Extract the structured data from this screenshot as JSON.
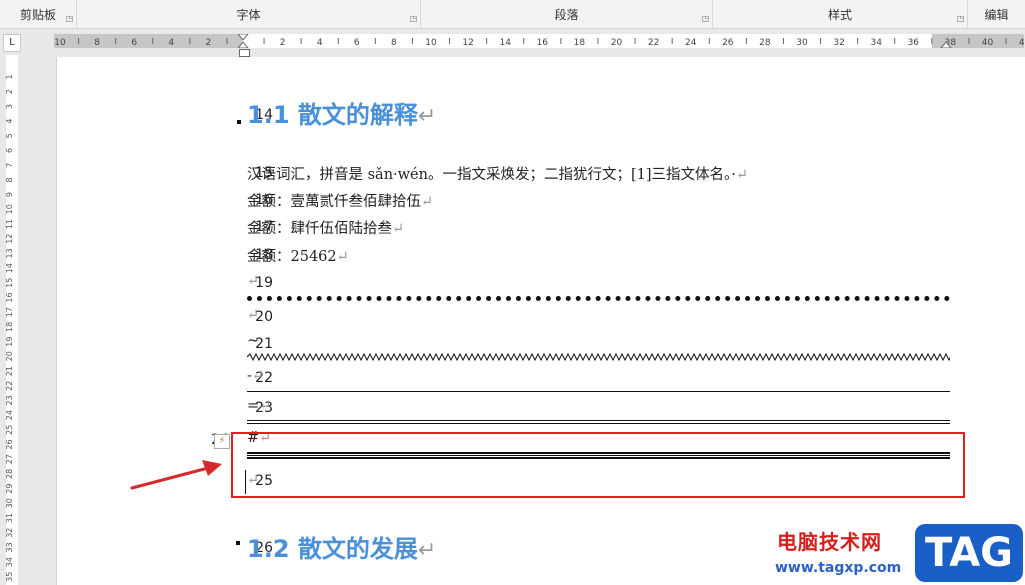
{
  "ribbon": {
    "groups": [
      {
        "label": "剪贴板"
      },
      {
        "label": "字体"
      },
      {
        "label": "段落"
      },
      {
        "label": "样式"
      },
      {
        "label": "编辑"
      }
    ]
  },
  "ruler": {
    "tab_selector": "L",
    "labels": [
      "10",
      "8",
      "6",
      "4",
      "2",
      "",
      "2",
      "4",
      "6",
      "8",
      "10",
      "12",
      "14",
      "16",
      "18",
      "20",
      "22",
      "24",
      "26",
      "28",
      "30",
      "32",
      "34",
      "36",
      "38",
      "40",
      "42"
    ]
  },
  "vertical_ruler": {
    "labels": [
      "1",
      "2",
      "3",
      "4",
      "5",
      "6",
      "7",
      "8",
      "9",
      "10",
      "11",
      "12",
      "13",
      "14",
      "15",
      "16",
      "17",
      "18",
      "19",
      "20",
      "21",
      "22",
      "23",
      "24",
      "25",
      "26",
      "27",
      "28",
      "29",
      "30",
      "31",
      "32",
      "33",
      "34",
      "35"
    ]
  },
  "document": {
    "mark": "↵",
    "heading1": {
      "line": "14",
      "text": "1.1 散文的解释"
    },
    "line15": {
      "line": "15",
      "text": "汉语词汇，拼音是 sǎn·wén。一指文采焕发；二指犹行文；[1]三指文体名。·"
    },
    "line16": {
      "line": "16",
      "text": "金额：壹萬贰仟叁佰肆拾伍"
    },
    "line17": {
      "line": "17",
      "text": "金额：肆仟伍佰陆拾叁"
    },
    "line18": {
      "line": "18",
      "text": "金额：25462"
    },
    "line19": {
      "line": "19",
      "text": ""
    },
    "line20": {
      "line": "20",
      "text": ""
    },
    "line21": {
      "line": "21",
      "text": "~"
    },
    "line22": {
      "line": "22",
      "text": "-"
    },
    "line23": {
      "line": "23",
      "text": "="
    },
    "line24": {
      "line": "24",
      "text": "#"
    },
    "line25": {
      "line": "25",
      "text": ""
    },
    "heading2": {
      "line": "26",
      "text": "1.2 散文的发展"
    }
  },
  "watermark": {
    "site_name": "电脑技术网",
    "url": "www.tagxp.com",
    "logo": "TAG"
  },
  "colors": {
    "heading": "#4a90d9",
    "highlight_box": "#e02020",
    "arrow": "#d42a2a"
  }
}
